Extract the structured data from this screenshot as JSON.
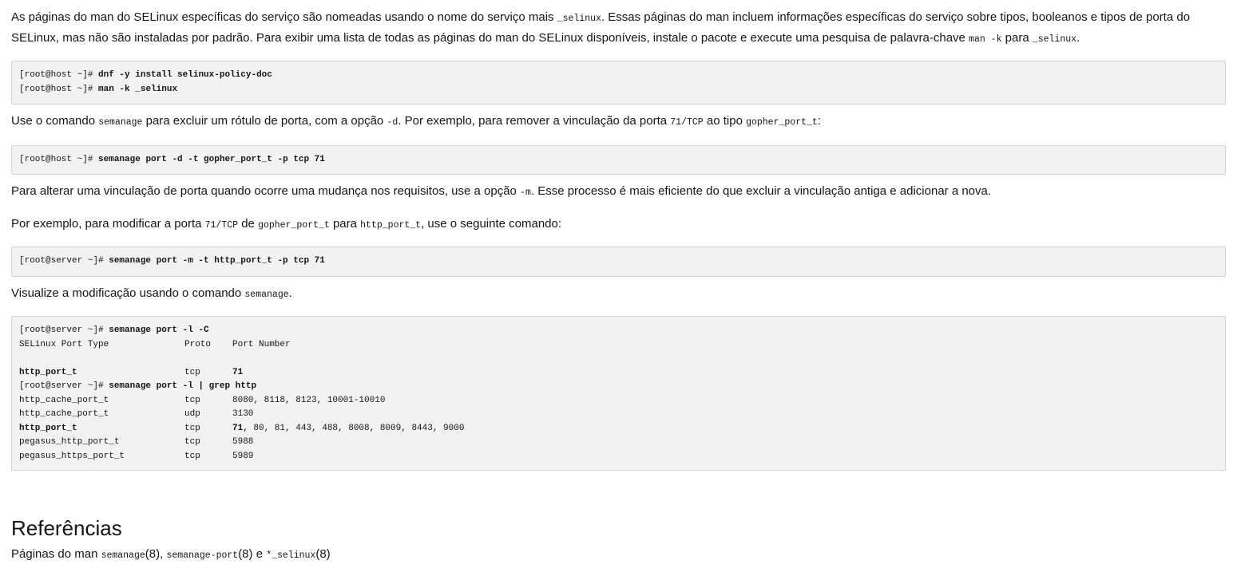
{
  "intro": {
    "part1": "As páginas do man do SELinux específicas do serviço são nomeadas usando o nome do serviço mais ",
    "code1": "_selinux",
    "part2": ". Essas páginas do man incluem informações específicas do serviço sobre tipos, booleanos e tipos de porta do SELinux, mas não são instaladas por padrão. Para exibir uma lista de todas as páginas do man do SELinux disponíveis, instale o pacote e execute uma pesquisa de palavra-chave ",
    "code2": "man -k",
    "part3": " para ",
    "code3": "_selinux",
    "part4": "."
  },
  "block1": {
    "line1_prompt": "[root@host ~]# ",
    "line1_cmd": "dnf -y install selinux-policy-doc",
    "line2_prompt": "[root@host ~]# ",
    "line2_cmd": "man -k _selinux"
  },
  "para2": {
    "part1": "Use o comando ",
    "code1": "semanage",
    "part2": " para excluir um rótulo de porta, com a opção ",
    "code2": "-d",
    "part3": ". Por exemplo, para remover a vinculação da porta ",
    "code3": "71/TCP",
    "part4": " ao tipo ",
    "code4": "gopher_port_t",
    "part5": ":"
  },
  "block2": {
    "prompt": "[root@host ~]# ",
    "cmd": "semanage port -d -t gopher_port_t -p tcp 71"
  },
  "para3": {
    "part1": "Para alterar uma vinculação de porta quando ocorre uma mudança nos requisitos, use a opção ",
    "code1": "-m",
    "part2": ". Esse processo é mais eficiente do que excluir a vinculação antiga e adicionar a nova."
  },
  "para4": {
    "part1": "Por exemplo, para modificar a porta ",
    "code1": "71/TCP",
    "part2": " de ",
    "code2": "gopher_port_t",
    "part3": " para ",
    "code3": "http_port_t",
    "part4": ", use o seguinte comando:"
  },
  "block3": {
    "prompt": "[root@server ~]# ",
    "cmd": "semanage port -m -t http_port_t -p tcp 71"
  },
  "para5": {
    "part1": "Visualize a modificação usando o comando ",
    "code1": "semanage",
    "part2": "."
  },
  "block4": {
    "cmd1_prompt": "[root@server ~]# ",
    "cmd1": "semanage port -l -C",
    "header": {
      "type": "SELinux Port Type",
      "proto": "Proto",
      "number": "Port Number"
    },
    "row_c": {
      "type": "http_port_t",
      "proto": "tcp",
      "number": "71"
    },
    "cmd2_prompt": "[root@server ~]# ",
    "cmd2": "semanage port -l | grep http",
    "rows": [
      {
        "type": "http_cache_port_t",
        "proto": "tcp",
        "number_bold": "",
        "number": "8080, 8118, 8123, 10001-10010"
      },
      {
        "type": "http_cache_port_t",
        "proto": "udp",
        "number_bold": "",
        "number": "3130"
      },
      {
        "type": "http_port_t",
        "proto": "tcp",
        "number_bold": "71",
        "number": ", 80, 81, 443, 488, 8008, 8009, 8443, 9000"
      },
      {
        "type": "pegasus_http_port_t",
        "proto": "tcp",
        "number_bold": "",
        "number": "5988"
      },
      {
        "type": "pegasus_https_port_t",
        "proto": "tcp",
        "number_bold": "",
        "number": "5989"
      }
    ]
  },
  "references": {
    "heading": "Referências",
    "part1": "Páginas do man ",
    "code1": "semanage",
    "part2": "(8), ",
    "code2": "semanage-port",
    "part3": "(8) e ",
    "code3": "*_selinux",
    "part4": "(8)"
  }
}
